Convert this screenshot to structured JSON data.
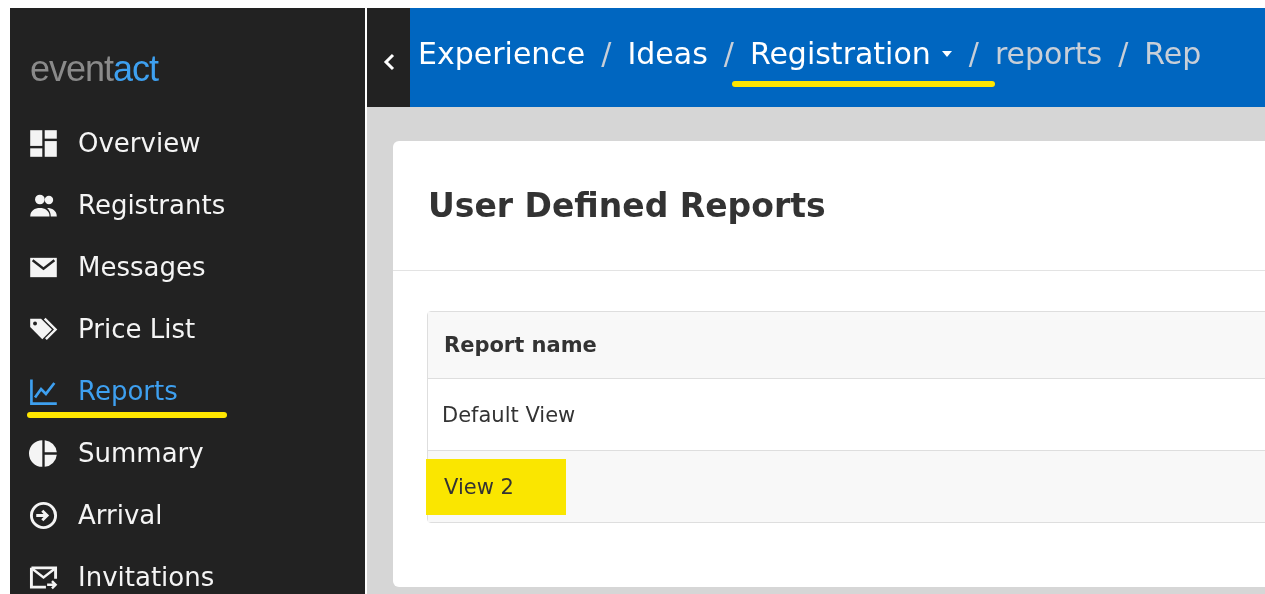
{
  "logo": {
    "parts": [
      {
        "text": "event",
        "kind": "muted"
      },
      {
        "text": "act",
        "kind": "accent"
      }
    ]
  },
  "sidebar": {
    "items": [
      {
        "label": "Overview",
        "selected": false,
        "highlighted": false
      },
      {
        "label": "Registrants",
        "selected": false,
        "highlighted": false
      },
      {
        "label": "Messages",
        "selected": false,
        "highlighted": false
      },
      {
        "label": "Price List",
        "selected": false,
        "highlighted": false
      },
      {
        "label": "Reports",
        "selected": true,
        "highlighted": true
      },
      {
        "label": "Summary",
        "selected": false,
        "highlighted": false
      },
      {
        "label": "Arrival",
        "selected": false,
        "highlighted": false
      },
      {
        "label": "Invitations",
        "selected": false,
        "highlighted": false
      }
    ]
  },
  "breadcrumbs": [
    {
      "label": "Experience",
      "muted": false,
      "dropdown": false,
      "highlighted": false,
      "separator": "/"
    },
    {
      "label": "Ideas",
      "muted": false,
      "dropdown": false,
      "highlighted": false,
      "separator": "/"
    },
    {
      "label": "Registration",
      "muted": false,
      "dropdown": true,
      "highlighted": true,
      "separator": "/"
    },
    {
      "label": "reports",
      "muted": true,
      "dropdown": false,
      "highlighted": false,
      "separator": "/"
    },
    {
      "label": "Rep",
      "muted": true,
      "dropdown": false,
      "highlighted": false
    }
  ],
  "card": {
    "title": "User Defined Reports"
  },
  "table": {
    "columns": [
      "Report name"
    ],
    "rows": [
      {
        "cells": [
          "Default View"
        ],
        "highlighted": false
      },
      {
        "cells": [
          "View 2"
        ],
        "highlighted": true
      }
    ]
  }
}
